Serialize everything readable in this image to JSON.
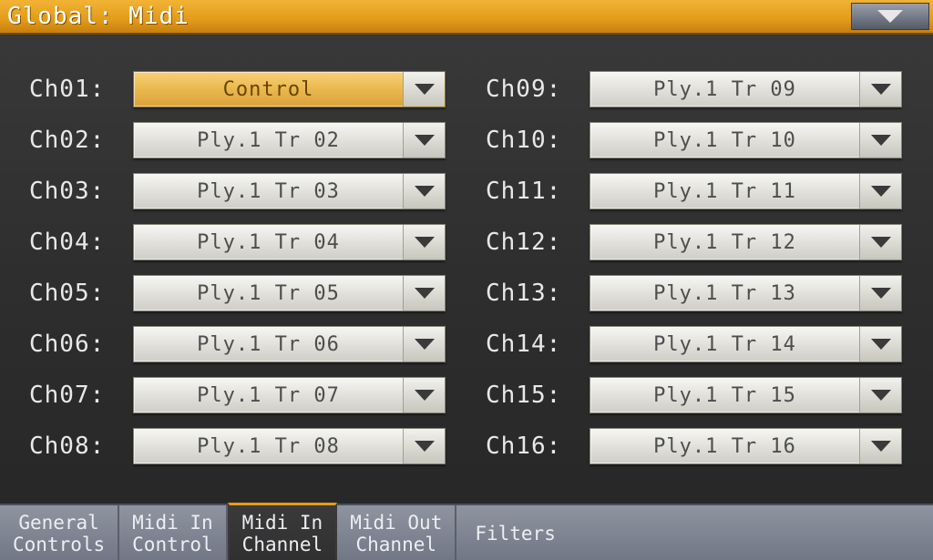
{
  "header": {
    "title": "Global: Midi"
  },
  "channels": {
    "left": [
      {
        "label": "Ch01:",
        "value": "Control",
        "selected": true
      },
      {
        "label": "Ch02:",
        "value": "Ply.1 Tr 02",
        "selected": false
      },
      {
        "label": "Ch03:",
        "value": "Ply.1 Tr 03",
        "selected": false
      },
      {
        "label": "Ch04:",
        "value": "Ply.1 Tr 04",
        "selected": false
      },
      {
        "label": "Ch05:",
        "value": "Ply.1 Tr 05",
        "selected": false
      },
      {
        "label": "Ch06:",
        "value": "Ply.1 Tr 06",
        "selected": false
      },
      {
        "label": "Ch07:",
        "value": "Ply.1 Tr 07",
        "selected": false
      },
      {
        "label": "Ch08:",
        "value": "Ply.1 Tr 08",
        "selected": false
      }
    ],
    "right": [
      {
        "label": "Ch09:",
        "value": "Ply.1 Tr 09",
        "selected": false
      },
      {
        "label": "Ch10:",
        "value": "Ply.1 Tr 10",
        "selected": false
      },
      {
        "label": "Ch11:",
        "value": "Ply.1 Tr 11",
        "selected": false
      },
      {
        "label": "Ch12:",
        "value": "Ply.1 Tr 12",
        "selected": false
      },
      {
        "label": "Ch13:",
        "value": "Ply.1 Tr 13",
        "selected": false
      },
      {
        "label": "Ch14:",
        "value": "Ply.1 Tr 14",
        "selected": false
      },
      {
        "label": "Ch15:",
        "value": "Ply.1 Tr 15",
        "selected": false
      },
      {
        "label": "Ch16:",
        "value": "Ply.1 Tr 16",
        "selected": false
      }
    ]
  },
  "tabs": [
    {
      "label": "General\nControls",
      "active": false
    },
    {
      "label": "Midi In\nControl",
      "active": false
    },
    {
      "label": "Midi In\nChannel",
      "active": true
    },
    {
      "label": "Midi Out\nChannel",
      "active": false
    },
    {
      "label": "Filters",
      "active": false
    }
  ]
}
